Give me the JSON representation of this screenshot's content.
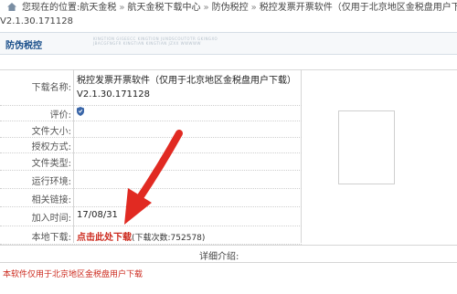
{
  "breadcrumb": {
    "prefix": "您现在的位置:",
    "items": [
      "航天金税",
      "航天金税下载中心",
      "防伪税控",
      "税控发票开票软件（仅用于北京地区金税盘用户下载）"
    ],
    "separator": "»",
    "continuation": "V2.1.30.171128"
  },
  "section": {
    "title": "防伪税控",
    "watermark": "KINGTION GIGEECC KINGTION JUNDSCOUTOTR GKINGXO JBACGFNGFR KINGTIAN KINGTIAN JZXX WWWWW"
  },
  "fields": [
    {
      "label": "下载名称:",
      "value": "税控发票开票软件（仅用于北京地区金税盘用户下载）V2.1.30.171128"
    },
    {
      "label": "评价:",
      "value": ""
    },
    {
      "label": "文件大小:",
      "value": ""
    },
    {
      "label": "授权方式:",
      "value": ""
    },
    {
      "label": "文件类型:",
      "value": ""
    },
    {
      "label": "运行环境:",
      "value": ""
    },
    {
      "label": "相关链接:",
      "value": ""
    },
    {
      "label": "加入时间:",
      "value": "17/08/31"
    },
    {
      "label": "本地下载:",
      "value": ""
    }
  ],
  "download": {
    "link_text": "点击此处下载",
    "count_text": "(下载次数:752578)"
  },
  "detail": {
    "label": "详细介绍:"
  },
  "footer_note": "本软件仅用于北京地区金税盘用户下载",
  "colors": {
    "accent": "#1a4f8b",
    "link_red": "#cc2a1e",
    "arrow": "#e12a22"
  },
  "icons": {
    "home": "home-icon",
    "rating": "rating-shield-icon",
    "arrow": "red-annotation-arrow"
  }
}
